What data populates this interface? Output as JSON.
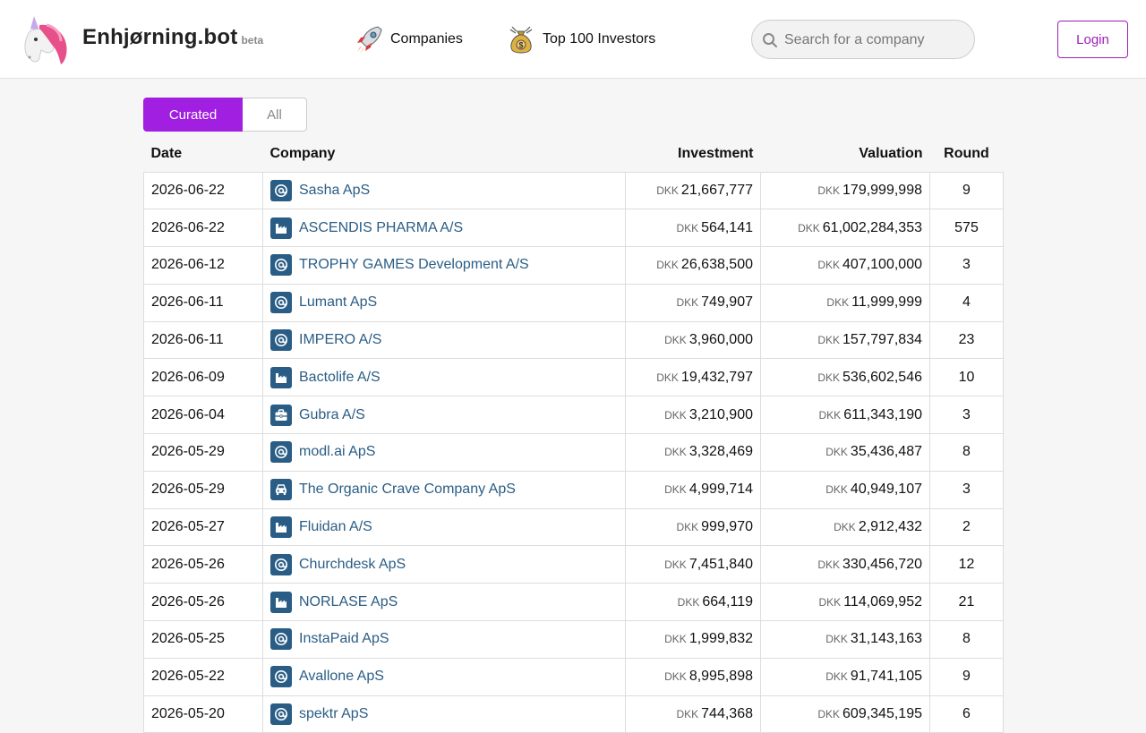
{
  "brand": {
    "name": "Enhjørning.bot",
    "badge": "beta",
    "logo_icon": "unicorn-icon"
  },
  "nav": [
    {
      "label": "Companies",
      "icon": "rocket-icon"
    },
    {
      "label": "Top 100 Investors",
      "icon": "money-bag-icon"
    }
  ],
  "search": {
    "placeholder": "Search for a company",
    "value": ""
  },
  "login_label": "Login",
  "toggle": {
    "curated": "Curated",
    "all": "All",
    "selected": "Curated"
  },
  "colors": {
    "accent": "#a11fe0",
    "link": "#2a5d85",
    "login": "#9d1fb8"
  },
  "table": {
    "headers": {
      "date": "Date",
      "company": "Company",
      "investment": "Investment",
      "valuation": "Valuation",
      "round": "Round"
    },
    "currency": "DKK",
    "rows": [
      {
        "date": "2026-06-22",
        "company": "Sasha ApS",
        "icon": "at-icon",
        "investment": "21,667,777",
        "valuation": "179,999,998",
        "round": "9"
      },
      {
        "date": "2026-06-22",
        "company": "ASCENDIS PHARMA A/S",
        "icon": "factory-icon",
        "investment": "564,141",
        "valuation": "61,002,284,353",
        "round": "575"
      },
      {
        "date": "2026-06-12",
        "company": "TROPHY GAMES Development A/S",
        "icon": "at-icon",
        "investment": "26,638,500",
        "valuation": "407,100,000",
        "round": "3"
      },
      {
        "date": "2026-06-11",
        "company": "Lumant ApS",
        "icon": "at-icon",
        "investment": "749,907",
        "valuation": "11,999,999",
        "round": "4"
      },
      {
        "date": "2026-06-11",
        "company": "IMPERO A/S",
        "icon": "at-icon",
        "investment": "3,960,000",
        "valuation": "157,797,834",
        "round": "23"
      },
      {
        "date": "2026-06-09",
        "company": "Bactolife A/S",
        "icon": "factory-icon",
        "investment": "19,432,797",
        "valuation": "536,602,546",
        "round": "10"
      },
      {
        "date": "2026-06-04",
        "company": "Gubra A/S",
        "icon": "briefcase-icon",
        "investment": "3,210,900",
        "valuation": "611,343,190",
        "round": "3"
      },
      {
        "date": "2026-05-29",
        "company": "modl.ai ApS",
        "icon": "at-icon",
        "investment": "3,328,469",
        "valuation": "35,436,487",
        "round": "8"
      },
      {
        "date": "2026-05-29",
        "company": "The Organic Crave Company ApS",
        "icon": "car-icon",
        "investment": "4,999,714",
        "valuation": "40,949,107",
        "round": "3"
      },
      {
        "date": "2026-05-27",
        "company": "Fluidan A/S",
        "icon": "factory-icon",
        "investment": "999,970",
        "valuation": "2,912,432",
        "round": "2"
      },
      {
        "date": "2026-05-26",
        "company": "Churchdesk ApS",
        "icon": "at-icon",
        "investment": "7,451,840",
        "valuation": "330,456,720",
        "round": "12"
      },
      {
        "date": "2026-05-26",
        "company": "NORLASE ApS",
        "icon": "factory-icon",
        "investment": "664,119",
        "valuation": "114,069,952",
        "round": "21"
      },
      {
        "date": "2026-05-25",
        "company": "InstaPaid ApS",
        "icon": "at-icon",
        "investment": "1,999,832",
        "valuation": "31,143,163",
        "round": "8"
      },
      {
        "date": "2026-05-22",
        "company": "Avallone ApS",
        "icon": "at-icon",
        "investment": "8,995,898",
        "valuation": "91,741,105",
        "round": "9"
      },
      {
        "date": "2026-05-20",
        "company": "spektr ApS",
        "icon": "at-icon",
        "investment": "744,368",
        "valuation": "609,345,195",
        "round": "6"
      }
    ]
  }
}
